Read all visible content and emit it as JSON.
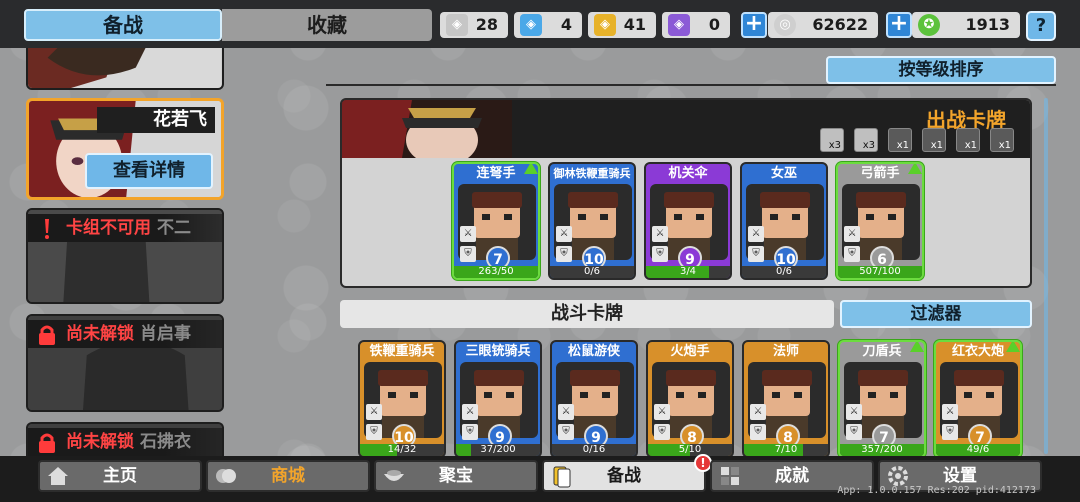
{
  "tabs": {
    "active": "备战",
    "other": "收藏"
  },
  "resources": [
    {
      "icon": "silver-shield-icon",
      "value": "28",
      "color": "#c6c6c6"
    },
    {
      "icon": "blue-shield-icon",
      "value": "4",
      "color": "#4aa8e8"
    },
    {
      "icon": "gold-shield-icon",
      "value": "41",
      "color": "#e7b22a"
    },
    {
      "icon": "purple-shield-icon",
      "value": "0",
      "color": "#8b5ad6"
    },
    {
      "icon": "silver-coin-icon",
      "value": "62622",
      "color": "#cfcfcf"
    },
    {
      "icon": "green-gem-icon",
      "value": "1913",
      "color": "#5cc23c"
    }
  ],
  "help_label": "?",
  "hero": {
    "name": "花若飞",
    "detail_button": "查看详情"
  },
  "left_cards": [
    {
      "status": "卡组不可用",
      "ghost": "不二",
      "icon": "warning-icon"
    },
    {
      "status": "尚未解锁",
      "ghost": "肖启事",
      "icon": "lock-icon"
    },
    {
      "status": "尚未解锁",
      "ghost": "石拂衣",
      "icon": "lock-icon"
    }
  ],
  "sort_button": "按等级排序",
  "deck": {
    "title": "出战卡牌",
    "slots": [
      {
        "label": "x3",
        "active": true
      },
      {
        "label": "x3",
        "active": true
      },
      {
        "label": "x1",
        "active": false
      },
      {
        "label": "x1",
        "active": false
      },
      {
        "label": "x1",
        "active": false
      },
      {
        "label": "x1",
        "active": false
      }
    ],
    "cards": [
      {
        "name": "连弩手",
        "level": "7",
        "progress": "263/50",
        "fill": 1.0,
        "upgradable": true,
        "color": "#2f6fd1"
      },
      {
        "name": "御林铁鞭重骑兵",
        "level": "10",
        "progress": "0/6",
        "fill": 0.0,
        "upgradable": false,
        "color": "#2f6fd1"
      },
      {
        "name": "机关伞",
        "level": "9",
        "progress": "3/4",
        "fill": 0.75,
        "upgradable": false,
        "color": "#8b3ad6"
      },
      {
        "name": "女巫",
        "level": "10",
        "progress": "0/6",
        "fill": 0.0,
        "upgradable": false,
        "color": "#2f6fd1"
      },
      {
        "name": "弓箭手",
        "level": "6",
        "progress": "507/100",
        "fill": 1.0,
        "upgradable": true,
        "color": "#9a9a9a"
      }
    ]
  },
  "battle_cards_label": "战斗卡牌",
  "filter_button": "过滤器",
  "battle_cards": [
    {
      "name": "铁鞭重骑兵",
      "level": "10",
      "progress": "14/32",
      "fill": 0.44,
      "upgradable": false,
      "color": "#d8902a"
    },
    {
      "name": "三眼铳骑兵",
      "level": "9",
      "progress": "37/200",
      "fill": 0.18,
      "upgradable": false,
      "color": "#2f6fd1"
    },
    {
      "name": "松鼠游侠",
      "level": "9",
      "progress": "0/16",
      "fill": 0.0,
      "upgradable": false,
      "color": "#2f6fd1"
    },
    {
      "name": "火炮手",
      "level": "8",
      "progress": "5/10",
      "fill": 0.5,
      "upgradable": false,
      "color": "#d8902a"
    },
    {
      "name": "法师",
      "level": "8",
      "progress": "7/10",
      "fill": 0.7,
      "upgradable": false,
      "color": "#d8902a"
    },
    {
      "name": "刀盾兵",
      "level": "7",
      "progress": "357/200",
      "fill": 1.0,
      "upgradable": true,
      "color": "#9a9a9a"
    },
    {
      "name": "红衣大炮",
      "level": "7",
      "progress": "49/6",
      "fill": 1.0,
      "upgradable": true,
      "color": "#d8902a"
    }
  ],
  "nav": [
    {
      "label": "主页",
      "icon": "home-icon"
    },
    {
      "label": "商城",
      "icon": "shop-coins-icon"
    },
    {
      "label": "聚宝",
      "icon": "treasure-bowl-icon"
    },
    {
      "label": "备战",
      "icon": "cards-icon",
      "active": true,
      "notification": "!"
    },
    {
      "label": "成就",
      "icon": "achievements-icon"
    },
    {
      "label": "设置",
      "icon": "gear-icon"
    }
  ],
  "build_info": "App: 1.0.0.157 Res:202 pid:412173"
}
